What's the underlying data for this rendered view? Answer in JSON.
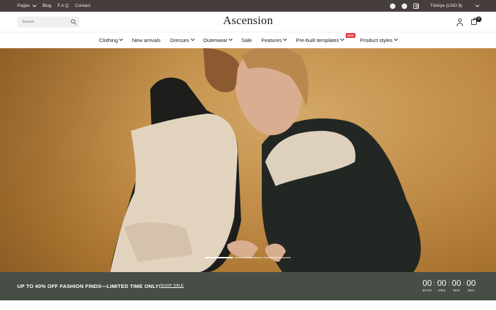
{
  "topbar": {
    "links": [
      "Pages",
      "Blog",
      "F.A.Q",
      "Contact"
    ],
    "social_icons": [
      "facebook-icon",
      "x-icon",
      "instagram-icon"
    ],
    "currency": "Türkiye (USD $)"
  },
  "header": {
    "logo": "Ascension",
    "search_placeholder": "Search",
    "cart_count": "0"
  },
  "nav": {
    "items": [
      {
        "label": "Clothing",
        "has_dropdown": true
      },
      {
        "label": "New arrivals",
        "has_dropdown": false
      },
      {
        "label": "Dresses",
        "has_dropdown": true
      },
      {
        "label": "Outerwear",
        "has_dropdown": true
      },
      {
        "label": "Sale",
        "has_dropdown": false
      },
      {
        "label": "Features",
        "has_dropdown": true
      },
      {
        "label": "Pre-built templates",
        "has_dropdown": true,
        "badge": "NEW"
      },
      {
        "label": "Product styles",
        "has_dropdown": true
      }
    ]
  },
  "hero": {
    "slides_total": 3,
    "active_slide": 1
  },
  "promo": {
    "text": "UP TO 40% OFF FASHION FINDS—LIMITED TIME ONLY!",
    "link": "SHOP SALE",
    "countdown": [
      {
        "value": "00",
        "label": "DAYS"
      },
      {
        "value": "00",
        "label": "HRS"
      },
      {
        "value": "00",
        "label": "MIN"
      },
      {
        "value": "00",
        "label": "SEC"
      }
    ]
  },
  "colors": {
    "topbar_bg": "#463d3d",
    "promo_bg": "#464e46",
    "badge_red": "#e2353c",
    "hero_bg": "#c08c47"
  }
}
